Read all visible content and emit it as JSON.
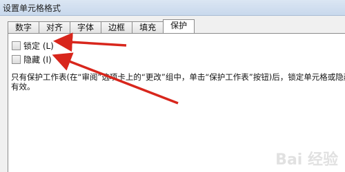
{
  "window": {
    "title": "设置单元格格式"
  },
  "tabs": [
    {
      "label": "数字"
    },
    {
      "label": "对齐"
    },
    {
      "label": "字体"
    },
    {
      "label": "边框"
    },
    {
      "label": "填充"
    },
    {
      "label": "保护"
    }
  ],
  "active_tab": "保护",
  "protection": {
    "locked": {
      "label": "锁定 (L)",
      "checked": false
    },
    "hidden": {
      "label": "隐藏 (I)",
      "checked": false
    },
    "description_line1": "只有保护工作表(在“审阅”选项卡上的“更改”组中，单击“保护工作表”按钮)后，锁定单元格或隐藏公式才",
    "description_line2": "有效。"
  },
  "annotation": {
    "arrow_color": "#d8261c"
  },
  "watermark": "Bai 经验"
}
